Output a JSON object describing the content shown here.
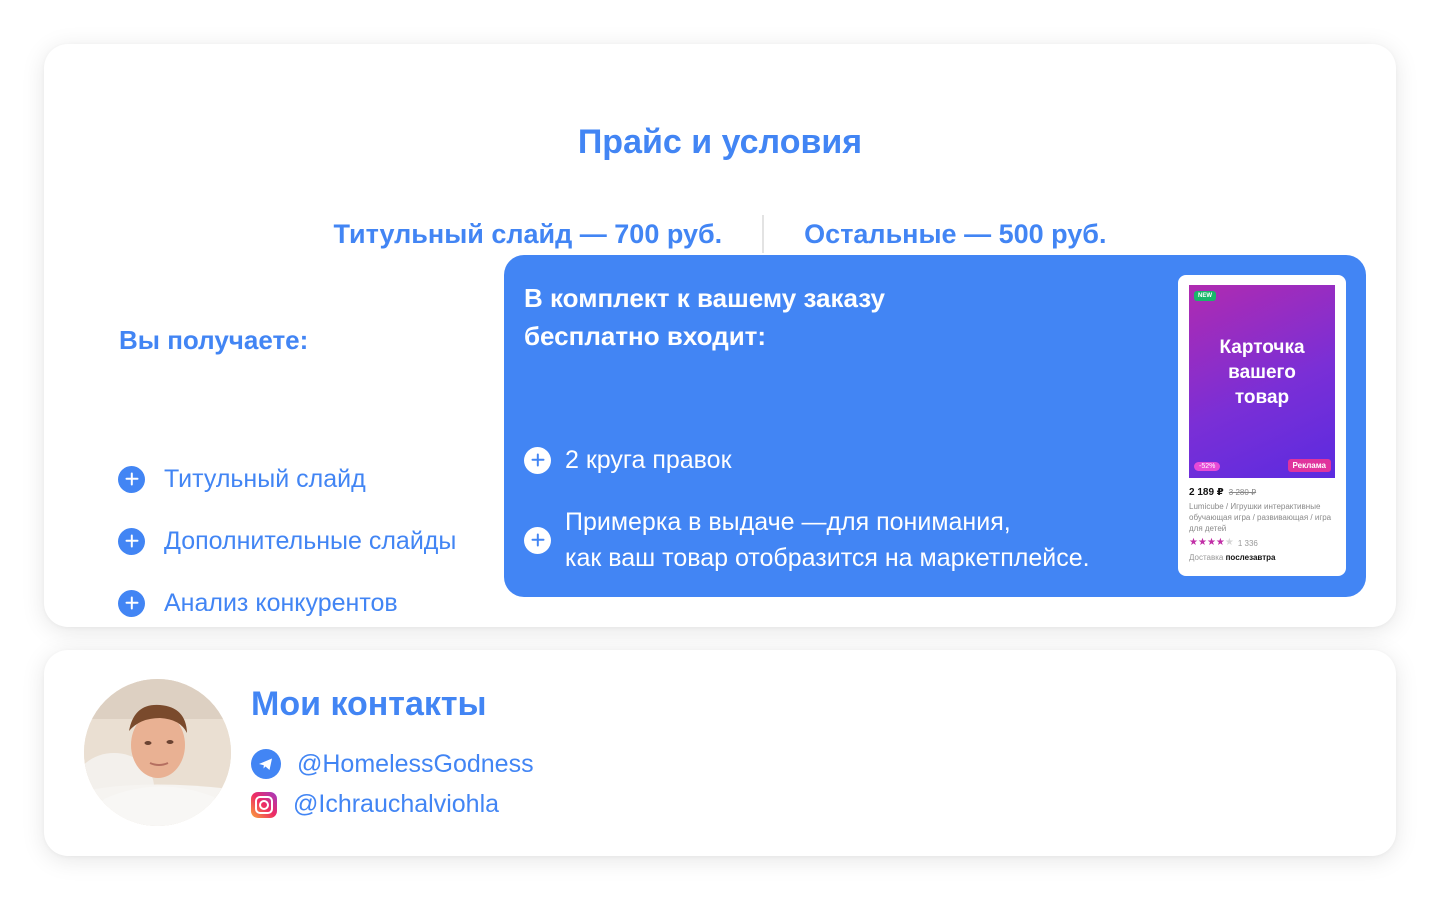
{
  "pricing": {
    "title": "Прайс и условия",
    "title_slide_price": "Титульный слайд — 700 руб.",
    "other_slides_price": "Остальные — 500 руб."
  },
  "you_get": {
    "title": "Вы получаете:",
    "items": [
      "Титульный слайд",
      "Дополнительные слайды",
      "Анализ конкурентов"
    ]
  },
  "bonus": {
    "title_line1": "В комплект к вашему заказу",
    "title_line2": "бесплатно входит:",
    "item1": "2 круга правок",
    "item2_line1": "Примерка в выдаче —для понимания,",
    "item2_line2": "как ваш товар отобразится на маркетплейсе."
  },
  "product_preview": {
    "badge_new": "NEW",
    "image_text": "Карточка вашего товар",
    "discount": "-52%",
    "ad_label": "Реклама",
    "price": "2 189 ₽",
    "old_price": "3 280 ₽",
    "description": "Lumicube / Игрушки интерактивные обучающая игра / развивающая / игра для детей",
    "rating_stars": 4,
    "rating_max": 5,
    "reviews_count": "1 336",
    "delivery_label": "Доставка",
    "delivery_value": "послезавтра"
  },
  "contacts": {
    "title": "Мои контакты",
    "telegram": "@HomelessGodness",
    "instagram": "@Ichrauchalviohla"
  },
  "colors": {
    "accent": "#4285f4",
    "white": "#ffffff"
  }
}
